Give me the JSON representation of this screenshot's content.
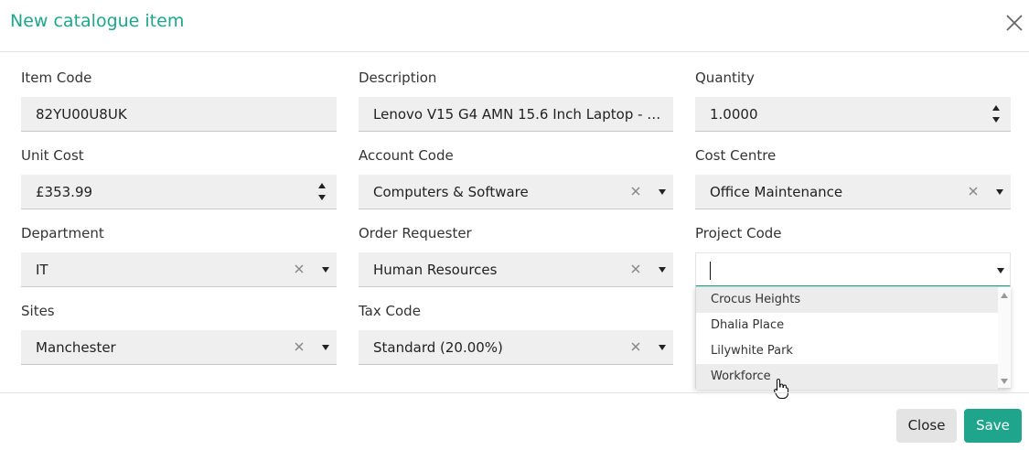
{
  "dialog": {
    "title": "New catalogue item"
  },
  "fields": {
    "item_code": {
      "label": "Item Code",
      "value": "82YU00U8UK"
    },
    "description": {
      "label": "Description",
      "value": "Lenovo V15 G4 AMN 15.6 Inch Laptop - A..."
    },
    "quantity": {
      "label": "Quantity",
      "value": "1.0000"
    },
    "unit_cost": {
      "label": "Unit Cost",
      "value": "£353.99"
    },
    "account_code": {
      "label": "Account Code",
      "value": "Computers & Software"
    },
    "cost_centre": {
      "label": "Cost Centre",
      "value": "Office Maintenance"
    },
    "department": {
      "label": "Department",
      "value": "IT"
    },
    "order_requester": {
      "label": "Order Requester",
      "value": "Human Resources"
    },
    "project_code": {
      "label": "Project Code",
      "value": ""
    },
    "sites": {
      "label": "Sites",
      "value": "Manchester"
    },
    "tax_code": {
      "label": "Tax Code",
      "value": "Standard (20.00%)"
    }
  },
  "project_code_options": [
    "Crocus Heights",
    "Dhalia Place",
    "Lilywhite Park",
    "Workforce"
  ],
  "buttons": {
    "close": "Close",
    "save": "Save"
  },
  "colors": {
    "accent": "#1fa58c",
    "input_bg": "#efefef",
    "close_button_bg": "#e4e4e4"
  },
  "icons": {
    "close": "close-icon",
    "clear": "clear-icon",
    "caret": "chevron-down-icon",
    "spinner": "spinner-arrows-icon",
    "pointer": "hand-pointer-icon"
  }
}
